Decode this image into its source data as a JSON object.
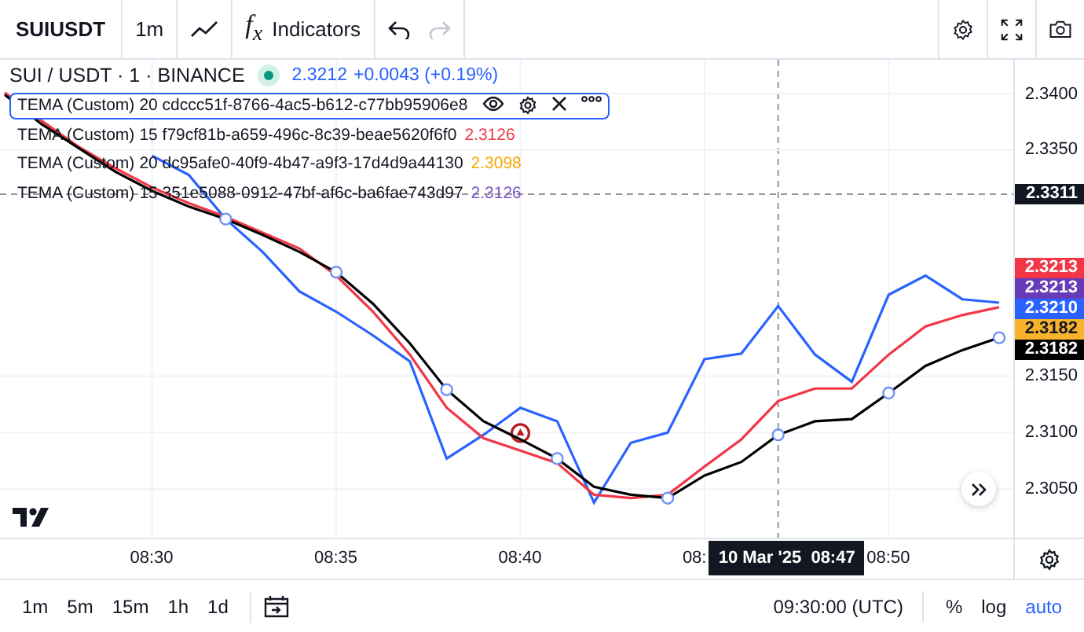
{
  "toolbar": {
    "symbol": "SUIUSDT",
    "interval": "1m",
    "indicators_icon": "f$_{x}$",
    "indicators_label": "Indicators",
    "undo": {
      "disabled": false
    },
    "redo": {
      "disabled": true
    }
  },
  "legend": {
    "title": "SUI / USDT · 1 · BINANCE",
    "price": "2.3212",
    "change": "+0.0043 (+0.19%)",
    "indicators": [
      {
        "name": "TEMA (Custom)",
        "args": "20 cdccc51f-8766-4ac5-b612-c77bb95906e8",
        "selected": true
      },
      {
        "name": "TEMA (Custom)",
        "args": "15 f79cf81b-a659-496c-8c39-beae5620f6f0",
        "value": "2.3126",
        "color": "#f23645",
        "selected": false
      },
      {
        "name": "TEMA (Custom)",
        "args": "20 dc95afe0-40f9-4b47-a9f3-17d4d9a44130",
        "value": "2.3098",
        "color": "#f7a600",
        "selected": false
      },
      {
        "name": "TEMA (Custom)",
        "args": "15 351e5088-0912-47bf-af6c-ba6fae743d97",
        "value": "2.3126",
        "color": "#7e57c2",
        "selected": false
      }
    ]
  },
  "time_axis": [
    "08:30",
    "08:35",
    "08:40",
    "08:",
    "08:50"
  ],
  "crosshair": {
    "time_label": "10 Mar '25  08:47"
  },
  "chart_data": {
    "type": "line",
    "grid": true,
    "ylim": [
      2.3007,
      2.343
    ],
    "yticks": [
      {
        "value": 2.305,
        "label": "2.3050"
      },
      {
        "value": 2.31,
        "label": "2.3100"
      },
      {
        "value": 2.315,
        "label": "2.3150"
      },
      {
        "value": 2.335,
        "label": "2.3350"
      },
      {
        "value": 2.34,
        "label": "2.3400"
      }
    ],
    "series": [
      {
        "color": "#2962ff",
        "values": [
          null,
          null,
          null,
          null,
          2.3345,
          2.3328,
          2.3289,
          2.326,
          2.3225,
          2.3207,
          2.3186,
          2.3163,
          2.3077,
          2.3098,
          2.3122,
          2.311,
          2.3038,
          2.3091,
          2.31,
          2.3165,
          2.317,
          2.3212,
          2.3169,
          2.3145,
          2.3222,
          2.3239,
          2.3218,
          2.3215
        ]
      },
      {
        "color": "#f23645",
        "values": [
          2.3401,
          2.3376,
          2.3353,
          2.3334,
          2.3317,
          2.3303,
          2.3291,
          2.3277,
          2.3263,
          2.3239,
          2.3207,
          2.3169,
          2.3122,
          2.3095,
          2.3084,
          2.3073,
          2.3045,
          2.3042,
          2.3045,
          2.307,
          2.3094,
          2.3128,
          2.3139,
          2.3139,
          2.3169,
          2.3194,
          2.3204,
          2.3211
        ]
      },
      {
        "color": "#000000",
        "values": [
          2.3399,
          2.3373,
          2.3352,
          2.3331,
          2.3314,
          2.33,
          2.3289,
          2.3275,
          2.326,
          2.3242,
          2.3214,
          2.3179,
          2.3138,
          2.311,
          2.3094,
          2.3077,
          2.3052,
          2.3045,
          2.3042,
          2.3062,
          2.3074,
          2.3098,
          2.311,
          2.3112,
          2.3135,
          2.3159,
          2.3173,
          2.3184
        ]
      }
    ],
    "ref_lines": [
      {
        "axis": "y",
        "value": 2.3311,
        "label": "2.3311"
      }
    ]
  },
  "price_labels": [
    {
      "text": "2.3213",
      "color": "#f23645"
    },
    {
      "text": "2.3213",
      "color": "#673ab7"
    },
    {
      "text": "2.3210",
      "color": "#2962ff"
    },
    {
      "text": "2.3182",
      "color": "#f7b32b"
    },
    {
      "text": "2.3182",
      "color": "#000000"
    }
  ],
  "intervals": [
    {
      "label": "1m",
      "selected": false
    },
    {
      "label": "5m",
      "selected": false
    },
    {
      "label": "15m",
      "selected": false
    },
    {
      "label": "1h",
      "selected": false
    },
    {
      "label": "1d",
      "selected": false
    }
  ],
  "clock": "09:30:00 (UTC)",
  "scale_modes": [
    {
      "label": "%",
      "selected": false
    },
    {
      "label": "log",
      "selected": false
    },
    {
      "label": "auto",
      "selected": true
    }
  ]
}
